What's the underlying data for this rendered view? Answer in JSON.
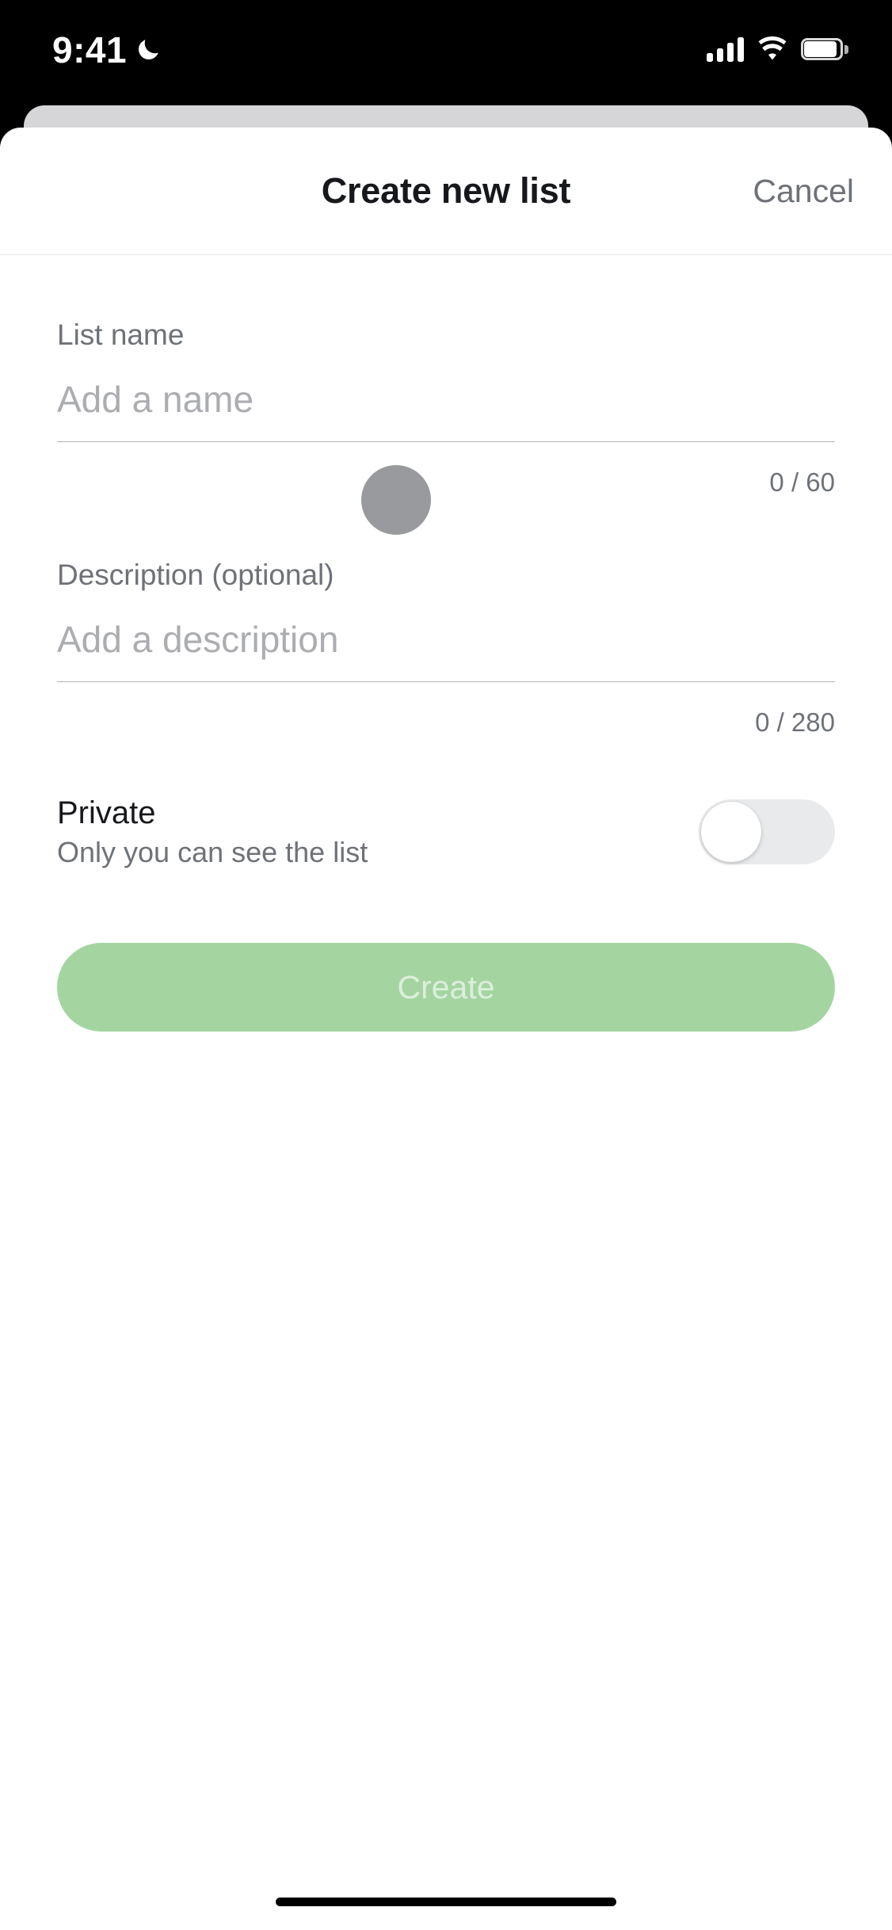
{
  "status_bar": {
    "time": "9:41",
    "icons": {
      "dnd": "crescent-moon-icon",
      "cellular": "signal-bars-icon",
      "wifi": "wifi-icon",
      "battery": "battery-full-icon"
    }
  },
  "modal": {
    "title": "Create new list",
    "cancel_label": "Cancel",
    "fields": {
      "name": {
        "label": "List name",
        "value": "",
        "placeholder": "Add a name",
        "counter": "0 / 60"
      },
      "description": {
        "label": "Description (optional)",
        "value": "",
        "placeholder": "Add a description",
        "counter": "0 / 280"
      }
    },
    "private": {
      "title": "Private",
      "subtitle": "Only you can see the list",
      "toggle_state": "off"
    },
    "submit": {
      "label": "Create",
      "state": "disabled"
    },
    "avatar_placeholder": "avatar-circle"
  },
  "colors": {
    "accent_green": "#A4D5A1",
    "text_primary": "#16181C",
    "text_secondary": "#6E7278",
    "placeholder": "#ACADB1",
    "toggle_track_off": "#E9EAEC",
    "sheet_behind": "#D6D5D8",
    "avatar_gray": "#989A9D"
  }
}
